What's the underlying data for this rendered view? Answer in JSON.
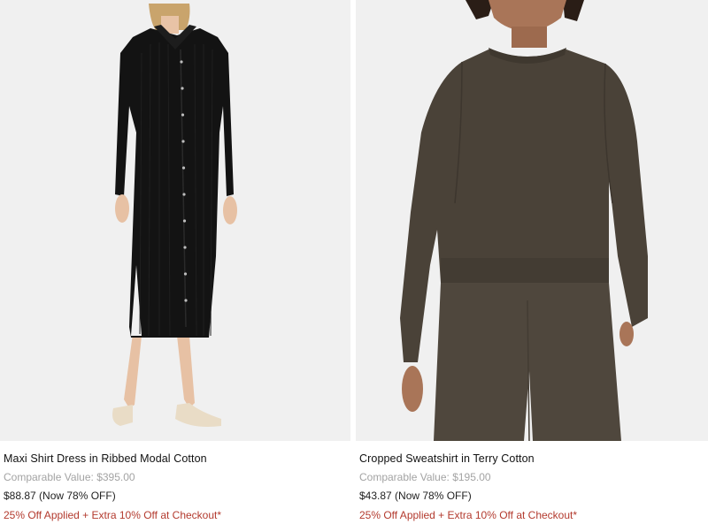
{
  "products": [
    {
      "title": "Maxi Shirt Dress in Ribbed Modal Cotton",
      "comparable_label": "Comparable Value:",
      "comparable_value": "$395.00",
      "price": "$88.87 (Now 78% OFF)",
      "promo": "25% Off Applied + Extra 10% Off at Checkout*",
      "image_icon": "product-photo-dress",
      "garment_color": "#131313"
    },
    {
      "title": "Cropped Sweatshirt in Terry Cotton",
      "comparable_label": "Comparable Value:",
      "comparable_value": "$195.00",
      "price": "$43.87 (Now 78% OFF)",
      "promo": "25% Off Applied + Extra 10% Off at Checkout*",
      "image_icon": "product-photo-sweatshirt",
      "garment_color": "#4a4238"
    }
  ],
  "colors": {
    "image_background": "#f0f0f0",
    "comparable_text": "#a3a3a3",
    "promo_text": "#b33a2e"
  }
}
